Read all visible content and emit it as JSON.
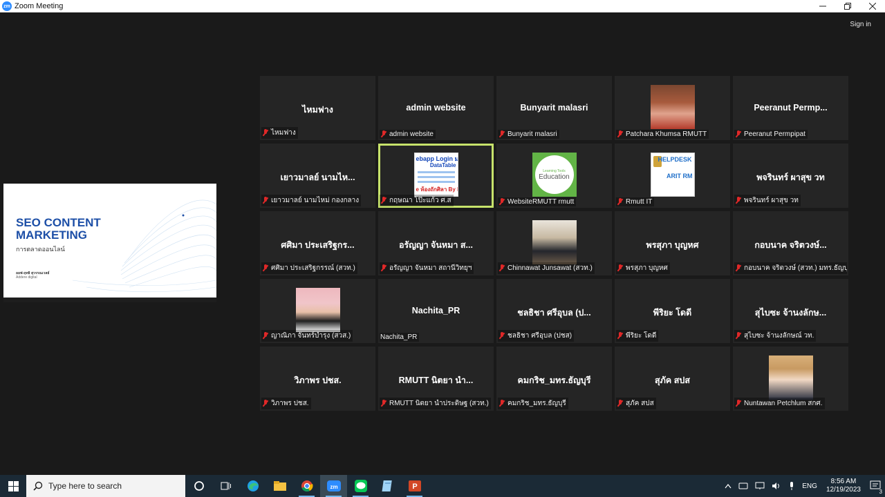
{
  "window": {
    "app_icon": "zm",
    "title": "Zoom Meeting",
    "controls": [
      "minimize-icon",
      "restore-icon",
      "close-icon"
    ]
  },
  "meeting": {
    "signin_label": "Sign in",
    "shared_screen": {
      "title": "SEO CONTENT MARKETING",
      "title_line1": "SEO CONTENT",
      "title_line2": "MARKETING",
      "subtitle": "การตลาดออนไลน์",
      "author": "ออฟ-ฤทธิ สุวรรณเวลธ์",
      "author_org": "Addere digital"
    },
    "active_color": "#c7e36b",
    "muted_color": "#e02828",
    "participants": [
      {
        "display": "ไหมฟาง",
        "label": "ไหมฟาง",
        "media": "name"
      },
      {
        "display": "admin website",
        "label": "admin website",
        "media": "name"
      },
      {
        "display": "Bunyarit malasri",
        "label": "Bunyarit malasri",
        "media": "name"
      },
      {
        "display": "",
        "label": "Patchara Khumsa RMUTT",
        "media": "photo-f"
      },
      {
        "display": "Peeranut  Permp...",
        "label": "Peeranut Permpipat",
        "media": "name"
      },
      {
        "display": "เยาวมาลย์ นามไห...",
        "label": "เยาวมาลย์ นามไหม่ กองกลาง",
        "media": "name"
      },
      {
        "display": "",
        "label": "กฤษณา โป๊ะแก้ว ศ.ส",
        "media": "webapp",
        "active": true
      },
      {
        "display": "",
        "label": "WebsiteRMUTT rmutt",
        "media": "edu"
      },
      {
        "display": "",
        "label": "Rmutt IT",
        "media": "help"
      },
      {
        "display": "พจรินทร์ ผาสุข วท",
        "label": "พจรินทร์ ผาสุข วท",
        "media": "name"
      },
      {
        "display": "ศศิมา ประเสริฐกร...",
        "label": "ศศิมา ประเสริฐกรรณ์ (สวท.)",
        "media": "name"
      },
      {
        "display": "อรัญญา จันหมา ส...",
        "label": "อรัญญา จันหมา สถานีวิทยุฯ",
        "media": "name"
      },
      {
        "display": "",
        "label": "Chinnawat Junsawat (สวท.)",
        "media": "photo-room"
      },
      {
        "display": "พรสุภา บุญหศ",
        "label": "พรสุภา บุญหศ",
        "media": "name"
      },
      {
        "display": "กอบนาค จริตวงษ์...",
        "label": "กอบนาค จริตวงษ์ (สวท.) มทร.ธัญบุรี",
        "media": "name"
      },
      {
        "display": "",
        "label": "ญาณิภา จันทร์บำรุง (สวส.)",
        "media": "photo-f2"
      },
      {
        "display": "Nachita_PR",
        "label": "Nachita_PR",
        "media": "name",
        "unmuted": true
      },
      {
        "display": "ชลธิชา ศรีอุบล (ป...",
        "label": "ชลธิชา ศรีอุบล (ปชส)",
        "media": "name"
      },
      {
        "display": "พีริยะ โดดี",
        "label": "พีริยะ โดดี",
        "media": "name"
      },
      {
        "display": "สุไบซะ จ้านงลักษ...",
        "label": "สุไบซะ จ้านงลักษณ์ วท.",
        "media": "name"
      },
      {
        "display": "วิภาพร  ปชส.",
        "label": "วิภาพร  ปชส.",
        "media": "name"
      },
      {
        "display": "RMUTT นิตยา นำ...",
        "label": "RMUTT นิตยา นำประดิษฐ (สวท.)",
        "media": "name"
      },
      {
        "display": "คมกริช_มทร.ธัญบุรี",
        "label": "คมกริช_มทร.ธัญบุรี",
        "media": "name"
      },
      {
        "display": "สุภัค สปส",
        "label": "สุภัค สปส",
        "media": "name"
      },
      {
        "display": "",
        "label": "Nuntawan Petchlum สกศ.",
        "media": "photo-m"
      }
    ],
    "webapp_thumb": {
      "line1": "ebapp Login ม",
      "line2": "DataTable",
      "line3": "e ห้องถักศิลา  By E"
    },
    "edu_thumb": {
      "small": "Learning Tools",
      "main": "Education"
    },
    "help_thumb": {
      "line1": "HELPDESK",
      "line2": "ARIT RM"
    }
  },
  "taskbar": {
    "search_placeholder": "Type here to search",
    "apps": [
      "cortana-icon",
      "task-view-icon",
      "edge-icon",
      "file-explorer-icon",
      "chrome-icon",
      "zoom-icon",
      "line-icon",
      "notepad-icon",
      "powerpoint-icon"
    ],
    "lang": "ENG",
    "time": "8:56 AM",
    "date": "12/19/2023",
    "notification_count": "3"
  }
}
